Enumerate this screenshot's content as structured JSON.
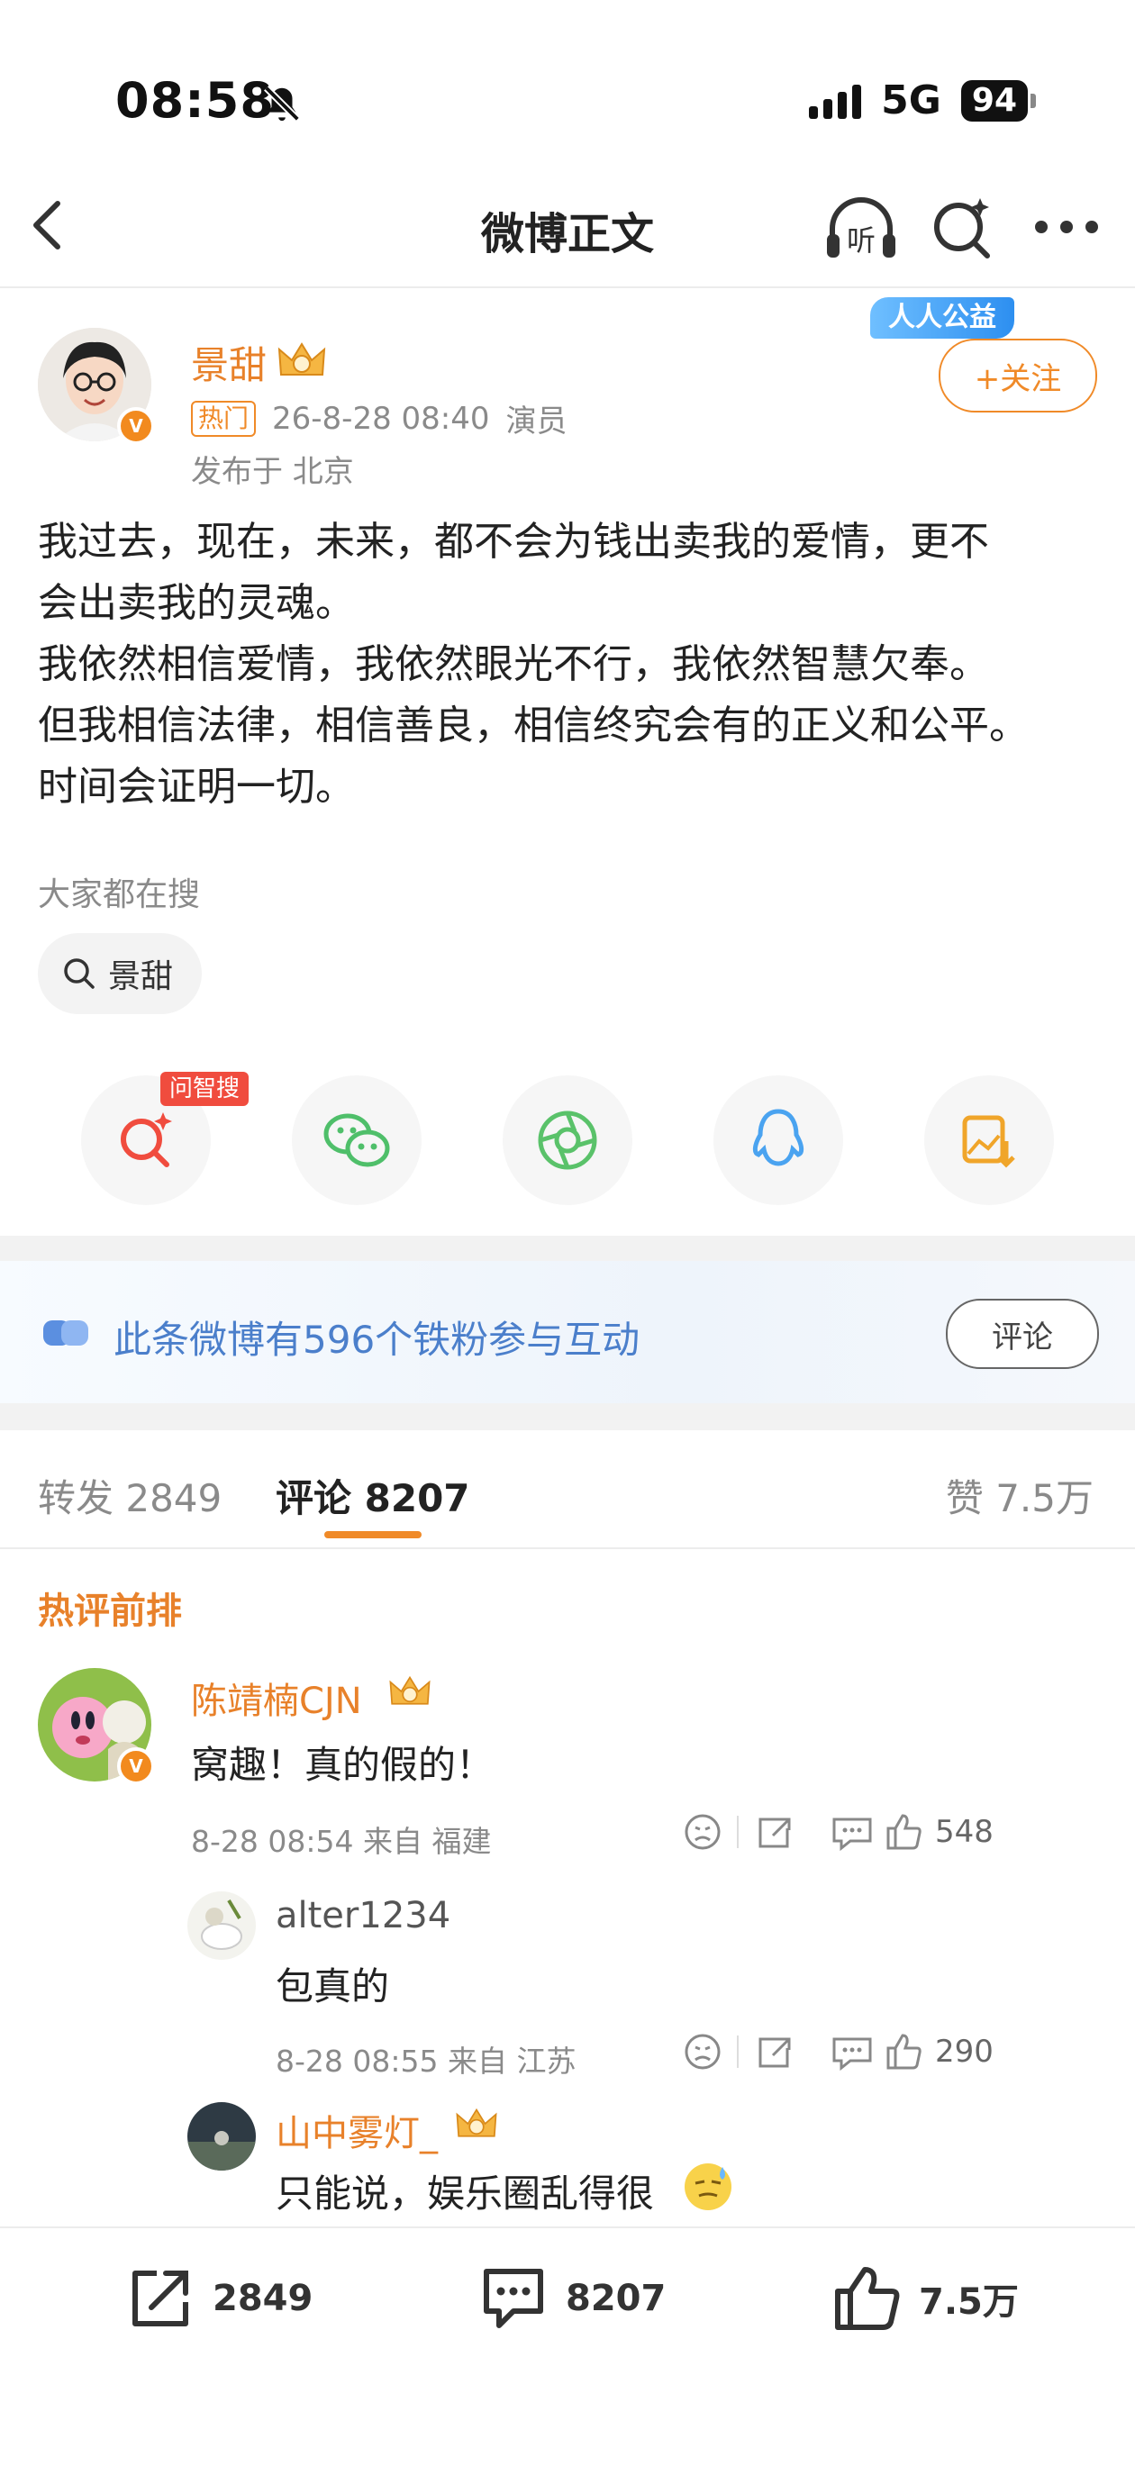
{
  "status_bar": {
    "time": "08:58",
    "network": "5G",
    "battery": "94"
  },
  "nav": {
    "title": "微博正文"
  },
  "post": {
    "author": "景甜",
    "badge_label": "人人公益",
    "hot_tag": "热门",
    "timestamp": "26-8-28 08:40",
    "occupation": "演员",
    "location": "发布于 北京",
    "follow_label": "+关注",
    "content_lines": [
      "我过去，现在，未来，都不会为钱出卖我的爱情，更不",
      "会出卖我的灵魂。",
      "我依然相信爱情，我依然眼光不行，我依然智慧欠奉。",
      "但我相信法律，相信善良，相信终究会有的正义和公平。",
      "时间会证明一切。"
    ]
  },
  "search": {
    "label": "大家都在搜",
    "chip": "景甜"
  },
  "share": {
    "ask_badge": "问智搜"
  },
  "fans": {
    "text": "此条微博有596个铁粉参与互动",
    "button": "评论"
  },
  "tabs": {
    "repost": "转发 2849",
    "comments": "评论 8207",
    "likes": "赞 7.5万"
  },
  "hot_heading": "热评前排",
  "comments": [
    {
      "name": "陈靖楠CJN",
      "text": "窝趣！真的假的！",
      "meta": "8-28 08:54  来自 福建",
      "likes": "548"
    },
    {
      "name": "alter1234",
      "text": "包真的",
      "meta": "8-28 08:55  来自 江苏",
      "likes": "290"
    },
    {
      "name": "山中雾灯_",
      "text": "只能说，娱乐圈乱得很"
    }
  ],
  "bottom_bar": {
    "repost": "2849",
    "comment": "8207",
    "like": "7.5万"
  },
  "colors": {
    "accent": "#e8812a",
    "link_blue": "#4b7fcb"
  }
}
